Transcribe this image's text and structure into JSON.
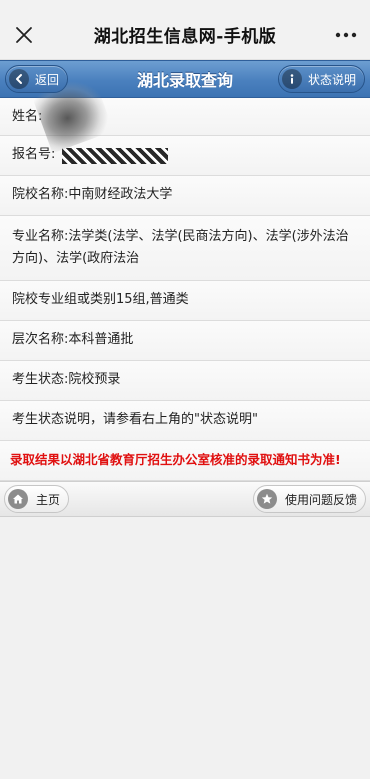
{
  "window": {
    "title": "湖北招生信息网-手机版",
    "close_icon": "close-icon",
    "more_icon": "more-dots-icon"
  },
  "nav": {
    "back_label": "返回",
    "title": "湖北录取查询",
    "status_label": "状态说明"
  },
  "rows": {
    "name": "姓名:",
    "reg_no": "报名号:",
    "school": "院校名称:中南财经政法大学",
    "major": "专业名称:法学类(法学、法学(民商法方向)、法学(涉外法治方向)、法学(政府法治",
    "group": "院校专业组或类别15组,普通类",
    "level": "层次名称:本科普通批",
    "status": "考生状态:院校预录",
    "status_note": "考生状态说明，请参看右上角的\"状态说明\"",
    "warning": "录取结果以湖北省教育厅招生办公室核准的录取通知书为准!"
  },
  "footer": {
    "home_label": "主页",
    "feedback_label": "使用问题反馈"
  },
  "colors": {
    "nav_blue": "#4a80be",
    "warning_red": "#e01010"
  }
}
